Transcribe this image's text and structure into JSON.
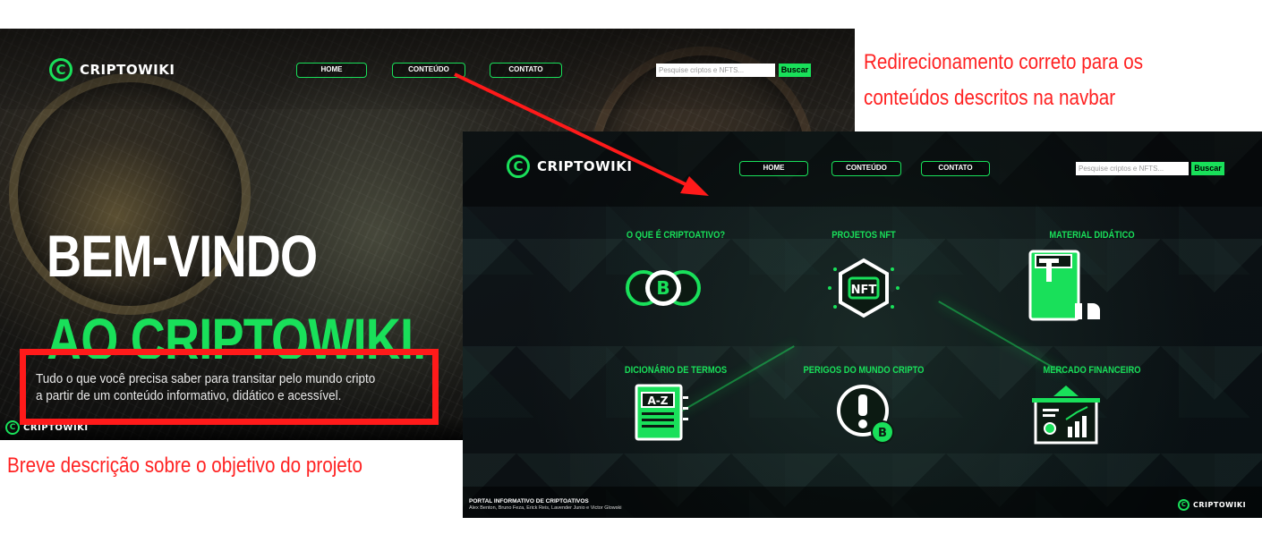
{
  "home_page": {
    "logo_text": "CRIPTOWIKI",
    "nav": {
      "home": "HOME",
      "content": "CONTEÚDO",
      "contact": "CONTATO"
    },
    "search": {
      "placeholder": "Pesquise criptos e NFTS...",
      "button": "Buscar"
    },
    "hero": {
      "line1": "BEM-VINDO",
      "line2": "AO CRIPTOWIKI.",
      "description_line1": "Tudo o que você precisa saber para transitar pelo mundo cripto",
      "description_line2": "a partir de um conteúdo informativo, didático e acessível."
    },
    "footer_logo_text": "CRIPTOWIKI"
  },
  "content_page": {
    "logo_text": "CRIPTOWIKI",
    "nav": {
      "home": "HOME",
      "content": "CONTEÚDO",
      "contact": "CONTATO"
    },
    "search": {
      "placeholder": "Pesquise criptos e NFTS...",
      "button": "Buscar"
    },
    "cards": [
      {
        "title": "O QUE É CRIPTOATIVO?",
        "icon": "crypto-coins-icon"
      },
      {
        "title": "PROJETOS NFT",
        "icon": "nft-hexagon-icon",
        "icon_text": "NFT"
      },
      {
        "title": "MATERIAL DIDÁTICO",
        "icon": "book-icon"
      },
      {
        "title": "DICIONÁRIO DE TERMOS",
        "icon": "dictionary-icon",
        "icon_text": "A-Z"
      },
      {
        "title": "PERIGOS DO MUNDO CRIPTO",
        "icon": "warning-icon"
      },
      {
        "title": "MERCADO FINANCEIRO",
        "icon": "market-chart-icon"
      }
    ],
    "footer": {
      "title": "PORTAL INFORMATIVO DE CRIPTOATIVOS",
      "authors": "Alex Benton, Bruno Feza, Erick Reis, Lavender Junio e Victor Glowski",
      "logo_text": "CRIPTOWIKI"
    }
  },
  "annotations": {
    "top_line1": "Redirecionamento correto para os",
    "top_line2": "conteúdos descritos na navbar",
    "bottom": "Breve descrição sobre o objetivo do projeto"
  },
  "colors": {
    "accent_green": "#19e05a",
    "annotation_red": "#ff1a1a"
  }
}
